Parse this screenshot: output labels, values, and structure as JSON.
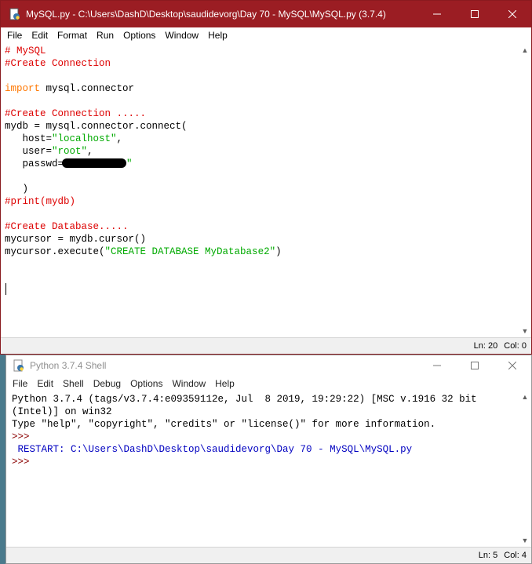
{
  "editor": {
    "title": "MySQL.py - C:\\Users\\DashD\\Desktop\\saudidevorg\\Day 70 - MySQL\\MySQL.py (3.7.4)",
    "menu": [
      "File",
      "Edit",
      "Format",
      "Run",
      "Options",
      "Window",
      "Help"
    ],
    "code": {
      "l1": "# MySQL",
      "l2": "#Create Connection",
      "l4_kw": "import",
      "l4_rest": " mysql.connector",
      "l6": "#Create Connection .....",
      "l7": "mydb = mysql.connector.connect(",
      "l8_a": "   host=",
      "l8_s": "\"localhost\"",
      "l8_c": ",",
      "l9_a": "   user=",
      "l9_s": "\"root\"",
      "l9_c": ",",
      "l10_a": "   passwd=",
      "l10_s": "\"",
      "l12": "   )",
      "l13": "#print(mydb)",
      "l15": "#Create Database.....",
      "l16": "mycursor = mydb.cursor()",
      "l17_a": "mycursor.execute(",
      "l17_s": "\"CREATE DATABASE MyDatabase2\"",
      "l17_c": ")"
    },
    "status": {
      "line": "Ln: 20",
      "col": "Col: 0"
    }
  },
  "shell": {
    "title": "Python 3.7.4 Shell",
    "menu": [
      "File",
      "Edit",
      "Shell",
      "Debug",
      "Options",
      "Window",
      "Help"
    ],
    "lines": {
      "l1": "Python 3.7.4 (tags/v3.7.4:e09359112e, Jul  8 2019, 19:29:22) [MSC v.1916 32 bit",
      "l2": "(Intel)] on win32",
      "l3": "Type \"help\", \"copyright\", \"credits\" or \"license()\" for more information.",
      "prompt": ">>>",
      "restart": " RESTART: C:\\Users\\DashD\\Desktop\\saudidevorg\\Day 70 - MySQL\\MySQL.py"
    },
    "status": {
      "line": "Ln: 5",
      "col": "Col: 4"
    }
  },
  "icons": {
    "app": "python-file-icon",
    "shell_app": "python-shell-icon",
    "minimize": "minimize-icon",
    "maximize": "maximize-icon",
    "close": "close-icon"
  },
  "colors": {
    "editor_titlebar": "#9b1d23",
    "comment": "#dd0000",
    "keyword": "#ff7700",
    "string": "#00aa00",
    "shell_prompt": "#8b0000",
    "shell_output": "#0000c0"
  }
}
